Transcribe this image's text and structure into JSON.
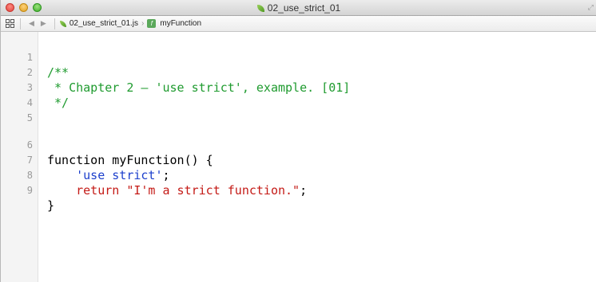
{
  "window": {
    "title": "02_use_strict_01"
  },
  "jumpbar": {
    "file_name": "02_use_strict_01.js",
    "symbol_badge": "f",
    "symbol_name": "myFunction"
  },
  "editor": {
    "lines": [
      {
        "number": "1",
        "text": "/**"
      },
      {
        "number": "2",
        "text": " * Chapter 2 – 'use strict', example. [01]"
      },
      {
        "number": "3",
        "text": " */"
      },
      {
        "number": "4",
        "text": ""
      },
      {
        "number": "5",
        "text": ""
      },
      {
        "number": "6",
        "keyword": "function",
        "name": " myFunction",
        "rest": "() {"
      },
      {
        "number": "7",
        "indent": "    ",
        "string": "'use strict'",
        "rest": ";"
      },
      {
        "number": "8",
        "indent": "    ",
        "keyword": "return",
        "string": "\"I'm a strict function.\"",
        "rest": ";"
      },
      {
        "number": "9",
        "text": "}"
      }
    ]
  },
  "colors": {
    "comment": "#1f9b2f",
    "string_single": "#1c3fcc",
    "string_double": "#c41a16",
    "gutter": "#f4f4f4"
  }
}
